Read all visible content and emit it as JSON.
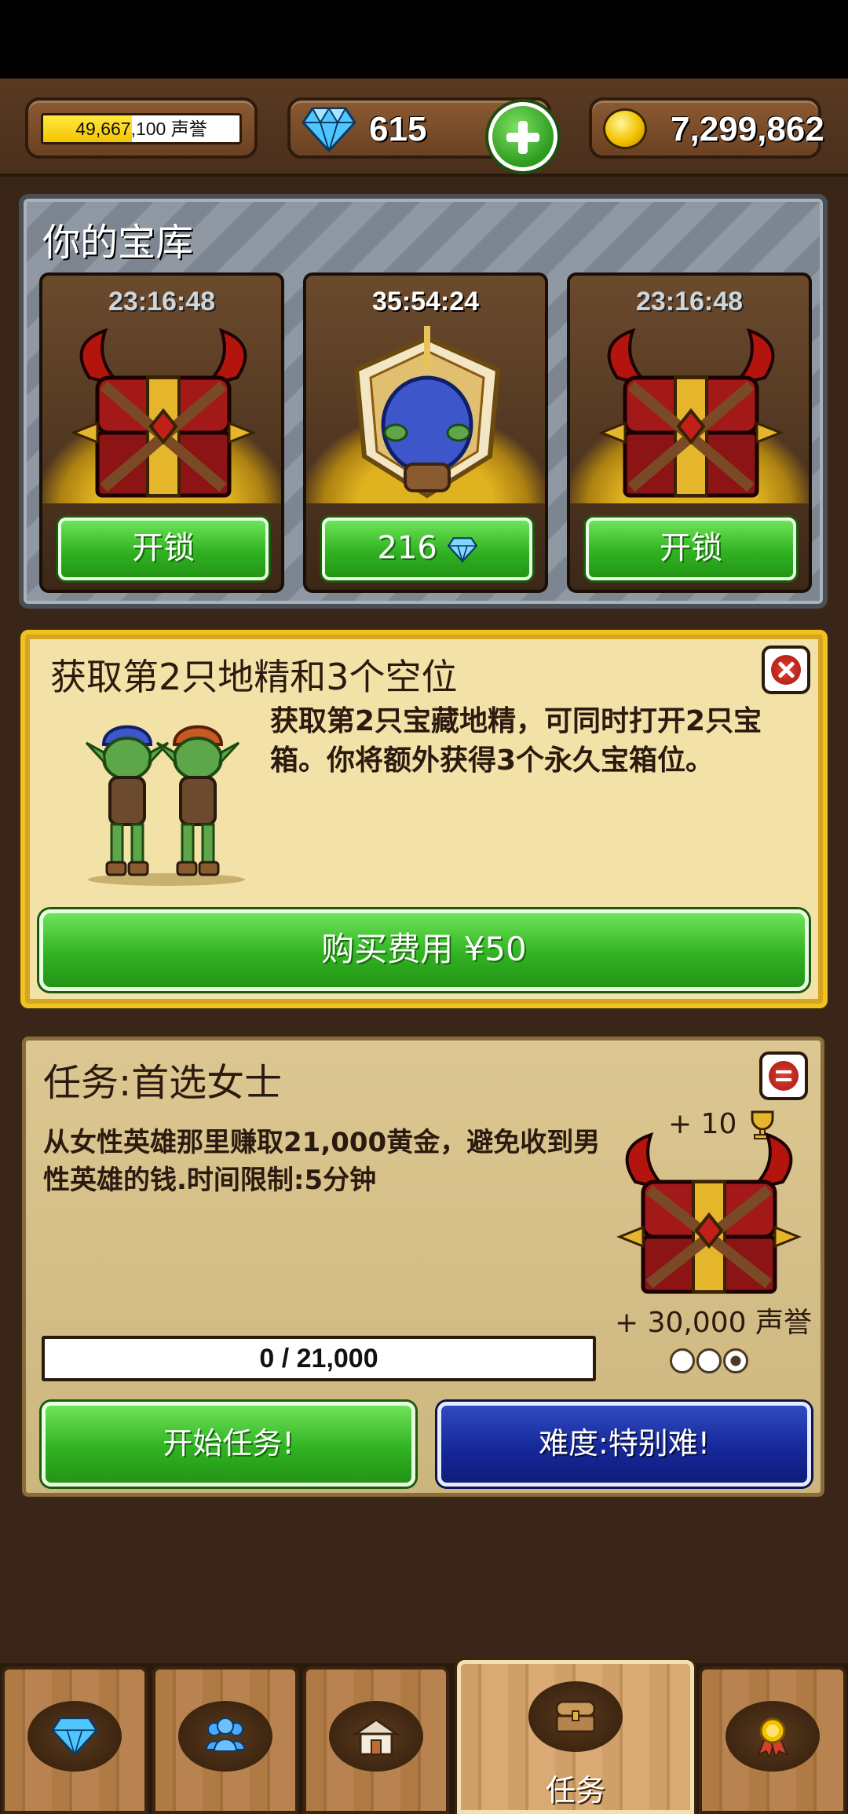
{
  "hud": {
    "reputation_text": "49,667,100 声誉",
    "reputation_progress": 0.45,
    "gems": "615",
    "gold": "7,299,862"
  },
  "vault": {
    "title": "你的宝库",
    "slots": [
      {
        "timer": "23:16:48",
        "button": "开锁",
        "active": false
      },
      {
        "timer": "35:54:24",
        "button": "216",
        "button_icon": "diamond-icon",
        "active": true
      },
      {
        "timer": "23:16:48",
        "button": "开锁",
        "active": false
      }
    ]
  },
  "offer": {
    "title": "获取第2只地精和3个空位",
    "description": "获取第2只宝藏地精，可同时打开2只宝箱。你将额外获得3个永久宝箱位。",
    "buy_label": "购买费用 ¥50"
  },
  "quest": {
    "title": "任务:首选女士",
    "description": "从女性英雄那里赚取21,000黄金，避免收到男性英雄的钱.时间限制:5分钟",
    "trophy_reward": "+ 10",
    "reputation_reward": "+ 30,000 声誉",
    "progress_text": "0 / 21,000",
    "progress_value": 0,
    "progress_max": 21000,
    "difficulty_level": 3,
    "difficulty_max": 3,
    "start_label": "开始任务!",
    "difficulty_label": "难度:特别难!"
  },
  "bottom_nav": {
    "tabs": [
      {
        "icon": "diamond-icon",
        "label": ""
      },
      {
        "icon": "heroes-icon",
        "label": ""
      },
      {
        "icon": "shop-icon",
        "label": ""
      },
      {
        "icon": "chest-icon",
        "label": "任务",
        "active": true
      },
      {
        "icon": "medal-icon",
        "label": ""
      }
    ]
  },
  "colors": {
    "green_button": "#31b322",
    "blue_button": "#16289a",
    "offer_border": "#f1c21d",
    "gold": "#f4c400"
  }
}
